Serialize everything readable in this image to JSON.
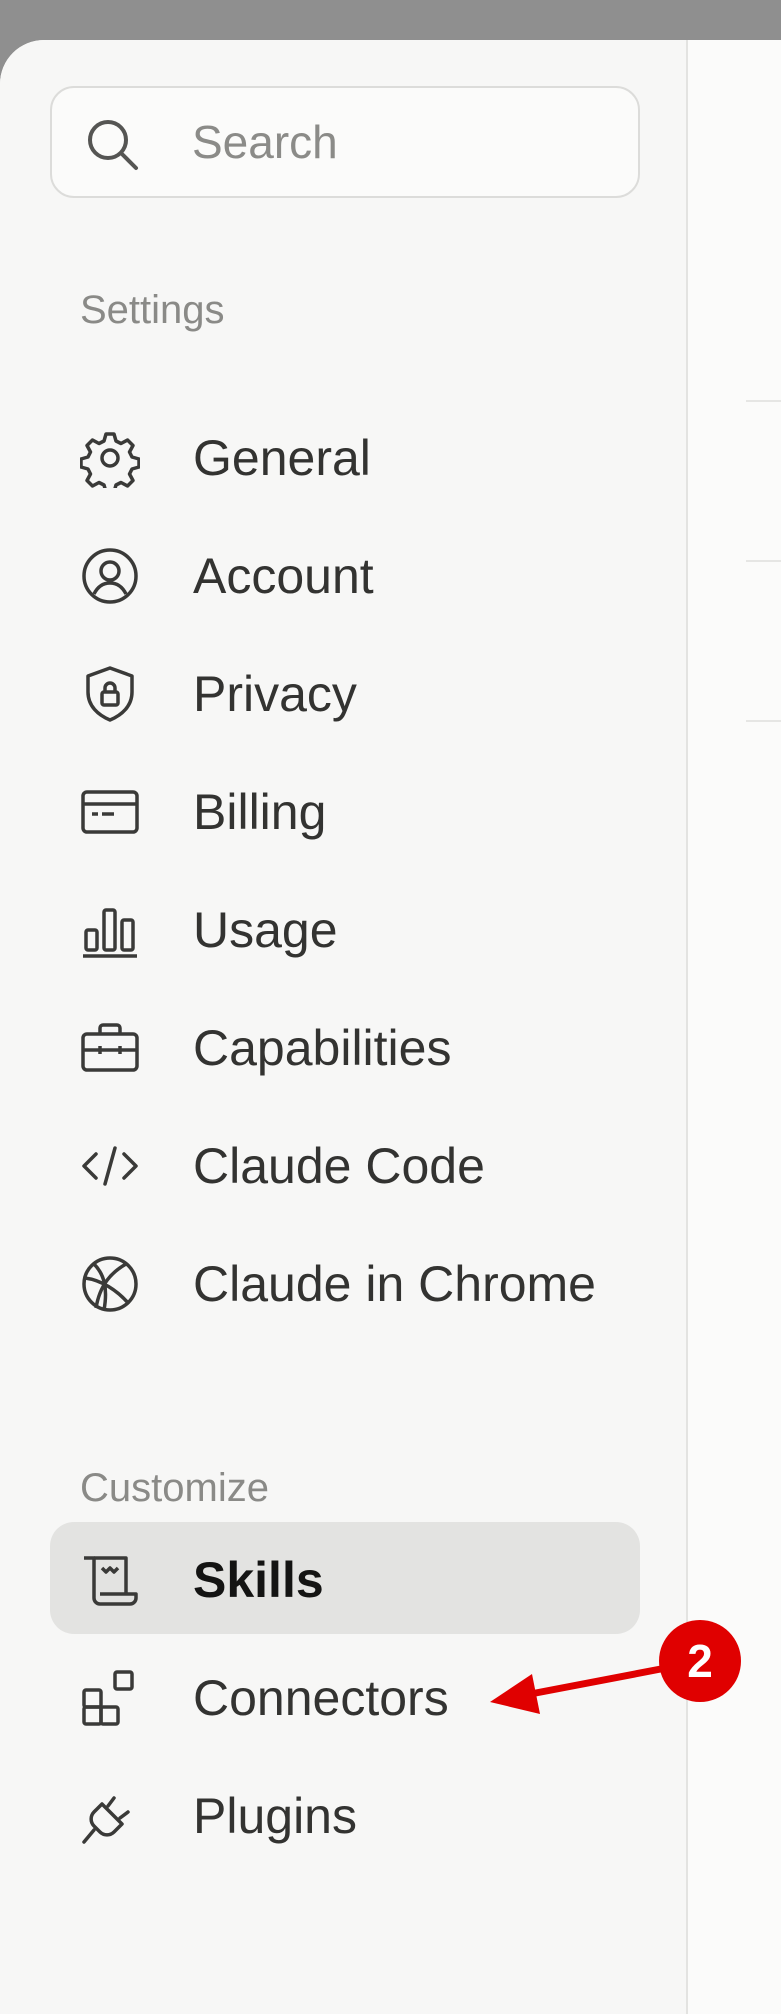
{
  "search": {
    "placeholder": "Search"
  },
  "sections": {
    "settings": {
      "label": "Settings",
      "items": [
        {
          "label": "General",
          "icon": "gear-icon"
        },
        {
          "label": "Account",
          "icon": "user-circle-icon"
        },
        {
          "label": "Privacy",
          "icon": "shield-lock-icon"
        },
        {
          "label": "Billing",
          "icon": "credit-card-icon"
        },
        {
          "label": "Usage",
          "icon": "bar-chart-icon"
        },
        {
          "label": "Capabilities",
          "icon": "briefcase-icon"
        },
        {
          "label": "Claude Code",
          "icon": "code-icon"
        },
        {
          "label": "Claude in Chrome",
          "icon": "globe-icon"
        }
      ]
    },
    "customize": {
      "label": "Customize",
      "items": [
        {
          "label": "Skills",
          "icon": "scroll-icon",
          "active": true
        },
        {
          "label": "Connectors",
          "icon": "blocks-icon"
        },
        {
          "label": "Plugins",
          "icon": "plug-icon"
        }
      ]
    }
  },
  "annotation": {
    "badge": "2",
    "color": "#e00000"
  }
}
